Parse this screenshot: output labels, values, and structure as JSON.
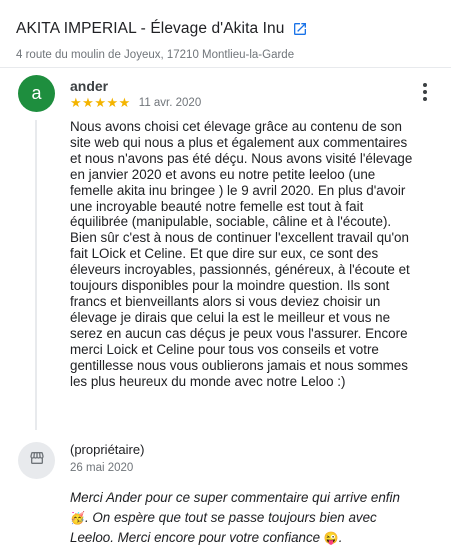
{
  "business": {
    "title": "AKITA IMPERIAL - Élevage d'Akita Inu",
    "address": "4 route du moulin de Joyeux, 17210 Montlieu-la-Garde",
    "link_icon": "external-link-icon"
  },
  "review": {
    "avatar_letter": "a",
    "avatar_color": "#1e8e3e",
    "author": "ander",
    "rating": 5,
    "date": "11 avr. 2020",
    "text": "Nous avons choisi cet élevage grâce au contenu de son site web qui nous a plus et également aux commentaires et nous n'avons pas été déçu. Nous avons visité l'élevage en janvier 2020 et avons eu notre petite leeloo (une femelle akita inu bringee ) le 9 avril 2020. En plus d'avoir une incroyable beauté notre femelle est tout à fait équilibrée (manipulable, sociable, câline et à l'écoute). Bien sûr c'est à nous de continuer l'excellent travail qu'on fait LOick et Celine. Et que dire sur eux, ce sont des éleveurs incroyables, passionnés, généreux, à l'écoute et toujours disponibles pour la moindre question. Ils sont francs et bienveillants alors si vous deviez choisir un élevage je dirais que celui la est le meilleur et vous ne serez en aucun cas déçus je peux vous l'assurer. Encore merci Loick et Celine pour tous vos conseils et votre gentillesse nous vous oublierons jamais et nous sommes les plus heureux du monde avec notre Leloo :)"
  },
  "owner_reply": {
    "label": "(propriétaire)",
    "icon": "storefront-icon",
    "date": "26 mai 2020",
    "text_part1": "Merci Ander pour ce super commentaire qui arrive enfin ",
    "emoji1": "🥳",
    "text_part2": ". On espère que tout se passe toujours bien avec Leeloo. Merci encore pour votre confiance ",
    "emoji2": "😜",
    "text_part3": "."
  },
  "colors": {
    "star": "#f4b400",
    "secondary_text": "#70757a",
    "link_blue": "#1a73e8"
  }
}
